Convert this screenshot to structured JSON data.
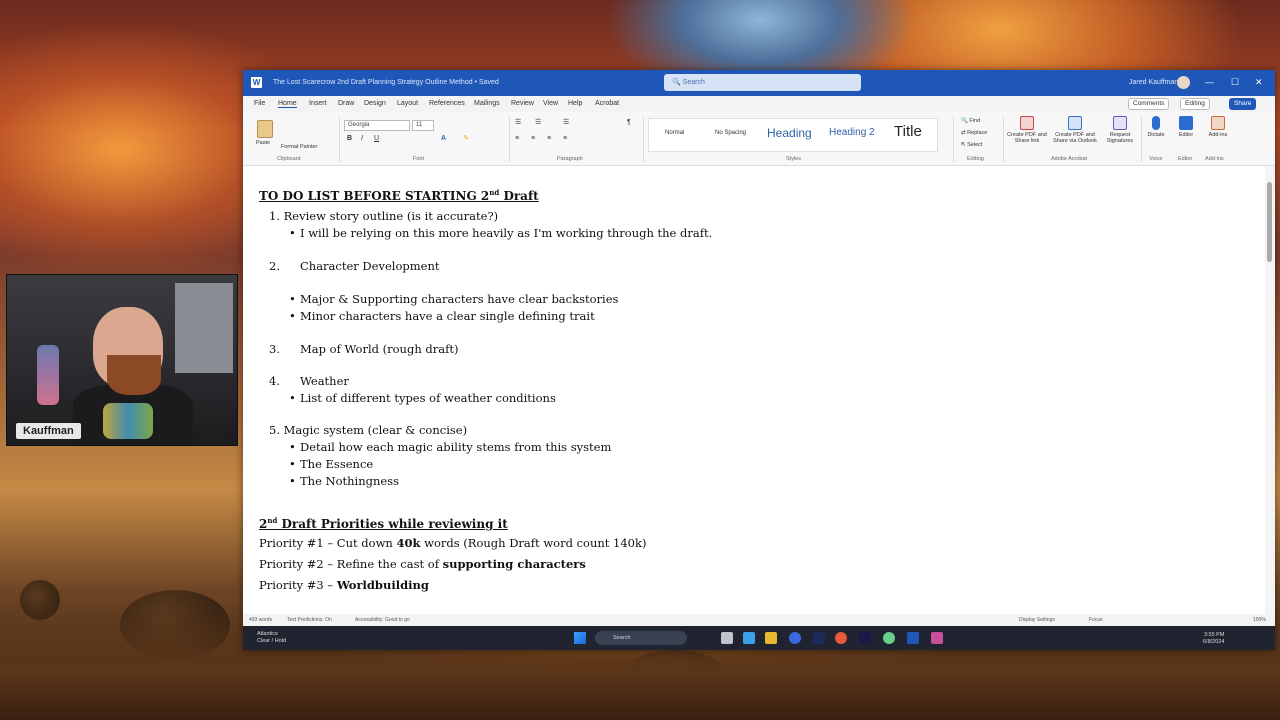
{
  "webcam": {
    "name": "Kauffman"
  },
  "window": {
    "app_icon": "W",
    "doc_title": "The Lost Scarecrow 2nd Draft Planning Strategy Outline Method • Saved",
    "search_placeholder": "Search",
    "user": "Jared Kauffman",
    "buttons": {
      "minimize": "—",
      "maximize": "☐",
      "close": "✕"
    }
  },
  "menu": {
    "tabs": [
      "File",
      "Home",
      "Insert",
      "Draw",
      "Design",
      "Layout",
      "References",
      "Mailings",
      "Review",
      "View",
      "Help",
      "Acrobat"
    ],
    "comments": "Comments",
    "editing": "Editing",
    "share": "Share"
  },
  "ribbon": {
    "paste": "Paste",
    "format_painter": "Format Painter",
    "clipboard": "Clipboard",
    "font_name": "Georgia",
    "font_size": "11",
    "font_group": "Font",
    "paragraph_group": "Paragraph",
    "styles_group": "Styles",
    "styles": [
      "Normal",
      "No Spacing",
      "Heading",
      "Heading 2",
      "Title"
    ],
    "find": "Find",
    "replace": "Replace",
    "select": "Select",
    "editing_group": "Editing",
    "create_pdf_share": "Create PDF and Share link",
    "create_pdf_outlook": "Create PDF and Share via Outlook",
    "request_signatures": "Request Signatures",
    "adobe_group": "Adobe Acrobat",
    "dictate": "Dictate",
    "voice_group": "Voice",
    "editor": "Editor",
    "editor_group": "Editor",
    "addins": "Add-ins",
    "addins_group": "Add-ins"
  },
  "document": {
    "heading1_pre": "TO DO LIST BEFORE STARTING 2",
    "heading1_sup": "nd",
    "heading1_post": " Draft",
    "item1": "1. Review story outline (is it accurate?)",
    "item1_b1": "I will be relying on this more heavily as I'm working through the draft.",
    "item2_num": "2.",
    "item2": "Character Development",
    "item2_b1": "Major & Supporting characters have clear backstories",
    "item2_b2": "Minor characters have a clear single defining trait",
    "item3_num": "3.",
    "item3": "Map of World (rough draft)",
    "item4_num": "4.",
    "item4": "Weather",
    "item4_b1": "List of different types of weather conditions",
    "item5": "5. Magic system (clear & concise)",
    "item5_b1": "Detail how each magic ability stems from this system",
    "item5_b2": "The Essence",
    "item5_b3": "The Nothingness",
    "heading2_num": "2",
    "heading2_sup": "nd",
    "heading2_post": " Draft Priorities while reviewing it",
    "p1_pre": "Priority #1 – Cut down ",
    "p1_bold": "40k",
    "p1_post": " words (Rough Draft word count 140k)",
    "p2_pre": "Priority #2 – Refine the cast of ",
    "p2_bold": "supporting characters",
    "p3_pre": "Priority #3 – ",
    "p3_bold": "Worldbuilding"
  },
  "status": {
    "words": "493 words",
    "predictions": "Text Predictions: On",
    "accessibility": "Accessibility: Good to go",
    "display": "Display Settings",
    "focus": "Focus",
    "zoom": "100%"
  },
  "taskbar": {
    "weather_title": "Atlantics",
    "weather_sub": "Clear / Hold",
    "search": "Search",
    "time": "3:55 PM",
    "date": "6/8/2024"
  }
}
